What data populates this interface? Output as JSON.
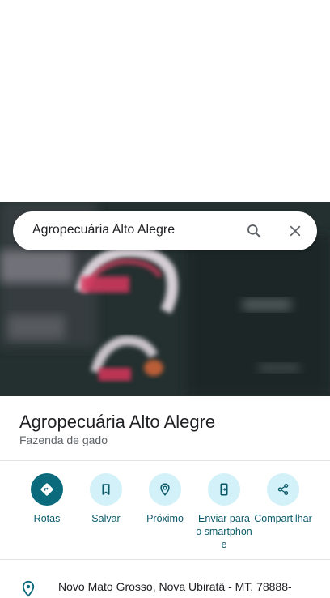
{
  "search": {
    "query": "Agropecuária Alto Alegre"
  },
  "place": {
    "title": "Agropecuária Alto Alegre",
    "category": "Fazenda de gado"
  },
  "actions": [
    {
      "label": "Rotas",
      "icon": "directions-icon"
    },
    {
      "label": "Salvar",
      "icon": "bookmark-icon"
    },
    {
      "label": "Próximo",
      "icon": "nearby-icon"
    },
    {
      "label": "Enviar para o smartphone",
      "icon": "send-to-phone-icon"
    },
    {
      "label": "Compartilhar",
      "icon": "share-icon"
    }
  ],
  "address": {
    "text": "Novo Mato Grosso, Nova Ubiratã - MT, 78888-"
  },
  "colors": {
    "accent": "#0b6b7d",
    "accent_light": "#d3f1f8",
    "label": "#0b5a6a"
  }
}
